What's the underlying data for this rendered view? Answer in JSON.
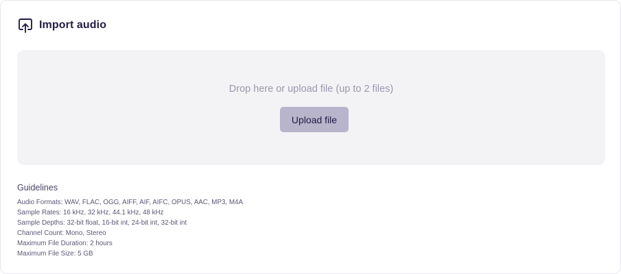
{
  "header": {
    "icon": "upload-cloud-icon",
    "title": "Import audio"
  },
  "dropzone": {
    "prompt": "Drop here or upload file (up to 2 files)",
    "upload_button_label": "Upload file"
  },
  "guidelines": {
    "heading": "Guidelines",
    "lines": [
      "Audio Formats: WAV, FLAC, OGG, AIFF, AIF, AIFC, OPUS, AAC, MP3, M4A",
      "Sample Rates: 16 kHz, 32 kHz, 44.1 kHz, 48 kHz",
      "Sample Depths: 32-bit float, 16-bit int, 24-bit int, 32-bit int",
      "Channel Count: Mono, Stereo",
      "Maximum File Duration: 2 hours",
      "Maximum File Size: 5 GB"
    ]
  },
  "colors": {
    "accent_button": "#b7b4cb",
    "dropzone_bg": "#f3f3f6",
    "title_text": "#241d44"
  }
}
